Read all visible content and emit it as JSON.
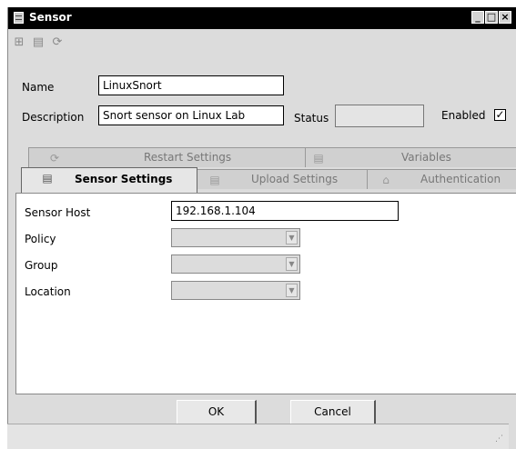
{
  "window": {
    "title": "Sensor"
  },
  "window_controls": {
    "minimize": "_",
    "maximize": "□",
    "close": "×"
  },
  "toolbar": {
    "icons": [
      "link-sensor-icon",
      "save-icon",
      "refresh-icon"
    ],
    "glyphs": {
      "link": "⊞",
      "save": "▤",
      "refresh": "⟳"
    }
  },
  "form": {
    "name_label": "Name",
    "name_value": "LinuxSnort",
    "description_label": "Description",
    "description_value": "Snort sensor on Linux Lab",
    "status_label": "Status",
    "status_value": "",
    "enabled_label": "Enabled",
    "enabled_checked": true,
    "check_mark": "✓"
  },
  "tabs": {
    "back_row": [
      {
        "label": "Restart Settings",
        "icon": "refresh-icon"
      },
      {
        "label": "Variables",
        "icon": "database-icon"
      }
    ],
    "front_row": [
      {
        "label": "Sensor Settings",
        "icon": "database-icon",
        "active": true
      },
      {
        "label": "Upload Settings",
        "icon": "database-icon",
        "active": false
      },
      {
        "label": "Authentication",
        "icon": "lock-icon",
        "active": false
      }
    ],
    "glyphs": {
      "refresh": "⟳",
      "database": "▤",
      "lock": "⌂"
    }
  },
  "sensor_settings": {
    "host_label": "Sensor Host",
    "host_value": "192.168.1.104",
    "policy_label": "Policy",
    "policy_value": "",
    "group_label": "Group",
    "group_value": "",
    "location_label": "Location",
    "location_value": "",
    "dropdown_glyph": "▼"
  },
  "buttons": {
    "ok": "OK",
    "cancel": "Cancel"
  },
  "statusbar": {
    "grip_glyph": "⋰"
  }
}
